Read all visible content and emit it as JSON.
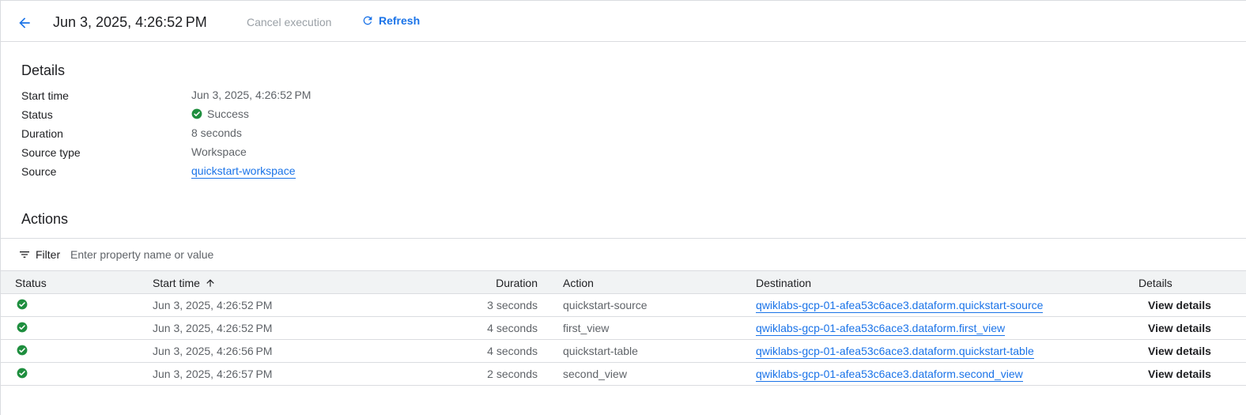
{
  "header": {
    "title": "Jun 3, 2025, 4:26:52 PM",
    "cancel_label": "Cancel execution",
    "refresh_label": "Refresh"
  },
  "details": {
    "section_title": "Details",
    "rows": [
      {
        "label": "Start time",
        "value": "Jun 3, 2025, 4:26:52 PM"
      },
      {
        "label": "Status",
        "value": "Success",
        "icon": "check-circle-icon"
      },
      {
        "label": "Duration",
        "value": "8 seconds"
      },
      {
        "label": "Source type",
        "value": "Workspace"
      },
      {
        "label": "Source",
        "value": "quickstart-workspace",
        "link": true
      }
    ]
  },
  "actions": {
    "section_title": "Actions",
    "filter_label": "Filter",
    "filter_placeholder": "Enter property name or value",
    "columns": {
      "status": "Status",
      "start_time": "Start time",
      "duration": "Duration",
      "action": "Action",
      "destination": "Destination",
      "details": "Details"
    },
    "rows": [
      {
        "status": "success",
        "start_time": "Jun 3, 2025, 4:26:52 PM",
        "duration": "3 seconds",
        "action": "quickstart-source",
        "destination": "qwiklabs-gcp-01-afea53c6ace3.dataform.quickstart-source",
        "details": "View details"
      },
      {
        "status": "success",
        "start_time": "Jun 3, 2025, 4:26:52 PM",
        "duration": "4 seconds",
        "action": "first_view",
        "destination": "qwiklabs-gcp-01-afea53c6ace3.dataform.first_view",
        "details": "View details"
      },
      {
        "status": "success",
        "start_time": "Jun 3, 2025, 4:26:56 PM",
        "duration": "4 seconds",
        "action": "quickstart-table",
        "destination": "qwiklabs-gcp-01-afea53c6ace3.dataform.quickstart-table",
        "details": "View details"
      },
      {
        "status": "success",
        "start_time": "Jun 3, 2025, 4:26:57 PM",
        "duration": "2 seconds",
        "action": "second_view",
        "destination": "qwiklabs-gcp-01-afea53c6ace3.dataform.second_view",
        "details": "View details"
      }
    ]
  },
  "colors": {
    "accent": "#1a73e8",
    "success": "#1e8e3e",
    "disabled": "#9aa0a6"
  }
}
